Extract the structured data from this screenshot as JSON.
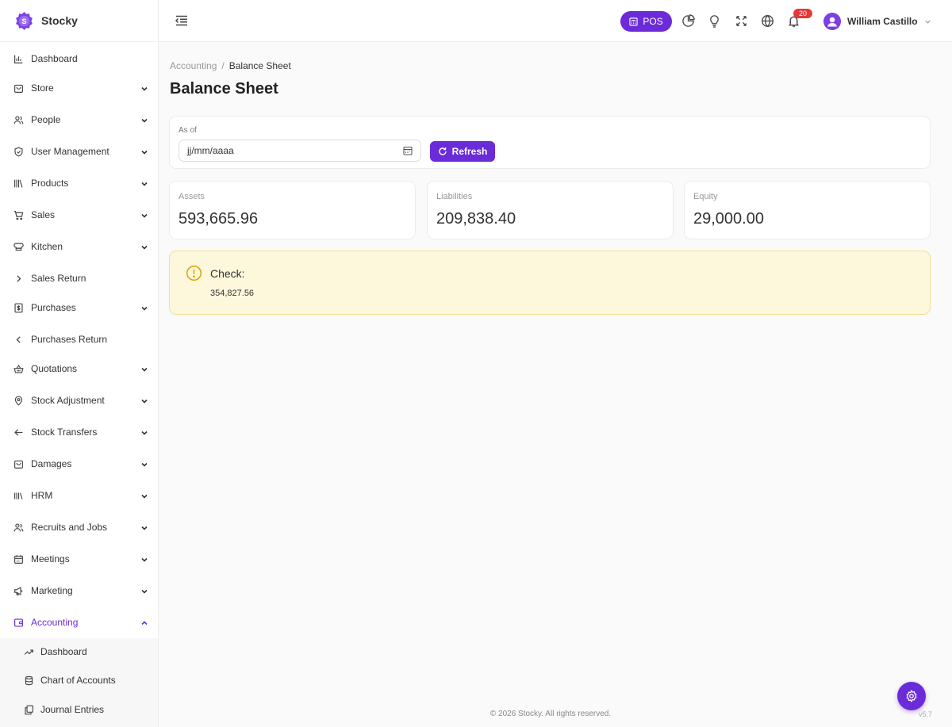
{
  "brand": {
    "name": "Stocky",
    "logo_letter": "S",
    "accent": "#6b2bd9"
  },
  "sidebar": {
    "items": [
      {
        "label": "Dashboard",
        "icon": "bar-chart-icon",
        "has_chevron": false
      },
      {
        "label": "Store",
        "icon": "store-bag-icon",
        "has_chevron": true
      },
      {
        "label": "People",
        "icon": "people-icon",
        "has_chevron": true
      },
      {
        "label": "User Management",
        "icon": "shield-icon",
        "has_chevron": true
      },
      {
        "label": "Products",
        "icon": "books-icon",
        "has_chevron": true
      },
      {
        "label": "Sales",
        "icon": "cart-icon",
        "has_chevron": true
      },
      {
        "label": "Kitchen",
        "icon": "chef-hat-icon",
        "has_chevron": true
      },
      {
        "label": "Sales Return",
        "icon": "chevron-right-icon",
        "has_chevron": false
      },
      {
        "label": "Purchases",
        "icon": "receipt-icon",
        "has_chevron": true
      },
      {
        "label": "Purchases Return",
        "icon": "chevron-left-icon",
        "has_chevron": false
      },
      {
        "label": "Quotations",
        "icon": "basket-icon",
        "has_chevron": true
      },
      {
        "label": "Stock Adjustment",
        "icon": "location-pin-icon",
        "has_chevron": true
      },
      {
        "label": "Stock Transfers",
        "icon": "arrow-left-icon",
        "has_chevron": true
      },
      {
        "label": "Damages",
        "icon": "store-bag-icon",
        "has_chevron": true
      },
      {
        "label": "HRM",
        "icon": "library-icon",
        "has_chevron": true
      },
      {
        "label": "Recruits and Jobs",
        "icon": "people-icon",
        "has_chevron": true
      },
      {
        "label": "Meetings",
        "icon": "calendar-icon",
        "has_chevron": true
      },
      {
        "label": "Marketing",
        "icon": "megaphone-icon",
        "has_chevron": true
      },
      {
        "label": "Accounting",
        "icon": "wallet-icon",
        "has_chevron": true,
        "active": true
      }
    ],
    "submenu": [
      {
        "label": "Dashboard",
        "icon": "trending-up-icon"
      },
      {
        "label": "Chart of Accounts",
        "icon": "database-icon"
      },
      {
        "label": "Journal Entries",
        "icon": "copy-icon"
      }
    ]
  },
  "topbar": {
    "pos_label": "POS",
    "notification_count": "20",
    "user_name": "William Castillo"
  },
  "breadcrumb": {
    "parent": "Accounting",
    "separator": "/",
    "current": "Balance Sheet"
  },
  "page": {
    "title": "Balance Sheet"
  },
  "filter": {
    "as_of_label": "As of",
    "date_placeholder": "jj/mm/aaaa",
    "refresh_label": "Refresh"
  },
  "stats": [
    {
      "label": "Assets",
      "value": "593,665.96"
    },
    {
      "label": "Liabilities",
      "value": "209,838.40"
    },
    {
      "label": "Equity",
      "value": "29,000.00"
    }
  ],
  "check": {
    "title": "Check:",
    "value": "354,827.56"
  },
  "footer": {
    "copyright": "© 2026 Stocky. All rights reserved.",
    "version": "v5.7"
  }
}
